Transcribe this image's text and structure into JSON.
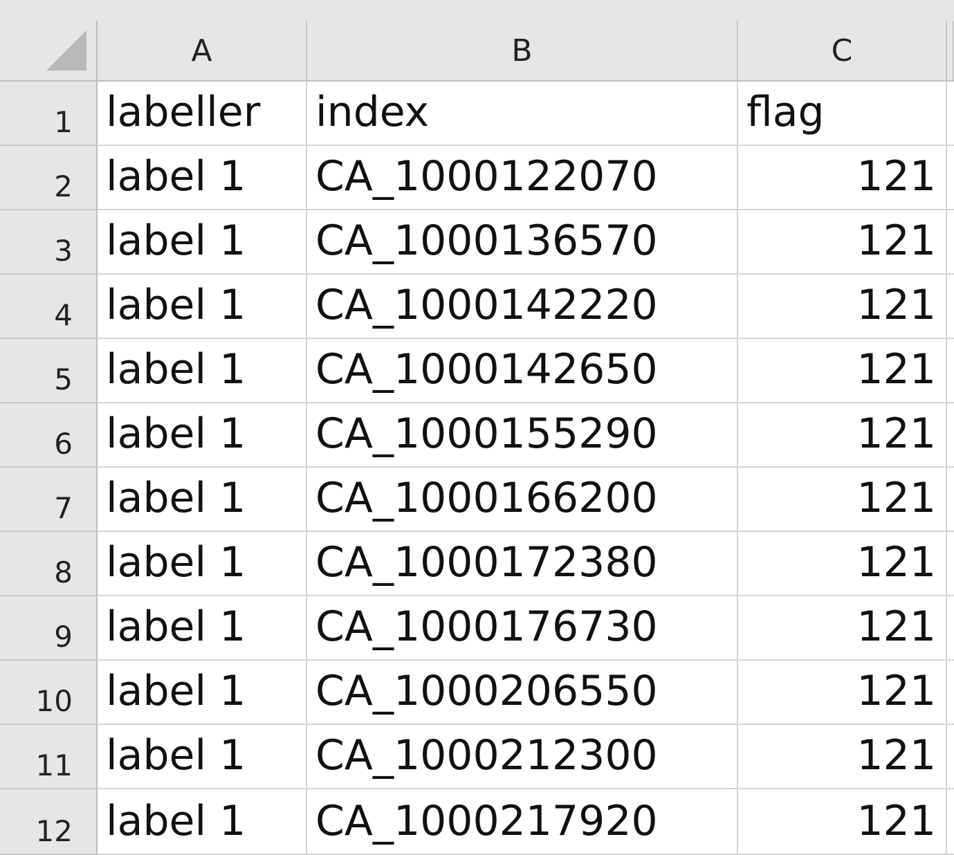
{
  "columns": [
    "A",
    "B",
    "C"
  ],
  "rows": [
    {
      "num": "1",
      "a": "labeller",
      "b": "index",
      "c": "flag"
    },
    {
      "num": "2",
      "a": "label 1",
      "b": "CA_1000122070",
      "c": "121"
    },
    {
      "num": "3",
      "a": "label 1",
      "b": "CA_1000136570",
      "c": "121"
    },
    {
      "num": "4",
      "a": "label 1",
      "b": "CA_1000142220",
      "c": "121"
    },
    {
      "num": "5",
      "a": "label 1",
      "b": "CA_1000142650",
      "c": "121"
    },
    {
      "num": "6",
      "a": "label 1",
      "b": "CA_1000155290",
      "c": "121"
    },
    {
      "num": "7",
      "a": "label 1",
      "b": "CA_1000166200",
      "c": "121"
    },
    {
      "num": "8",
      "a": "label 1",
      "b": "CA_1000172380",
      "c": "121"
    },
    {
      "num": "9",
      "a": "label 1",
      "b": "CA_1000176730",
      "c": "121"
    },
    {
      "num": "10",
      "a": "label 1",
      "b": "CA_1000206550",
      "c": "121"
    },
    {
      "num": "11",
      "a": "label 1",
      "b": "CA_1000212300",
      "c": "121"
    },
    {
      "num": "12",
      "a": "label 1",
      "b": "CA_1000217920",
      "c": "121"
    }
  ]
}
